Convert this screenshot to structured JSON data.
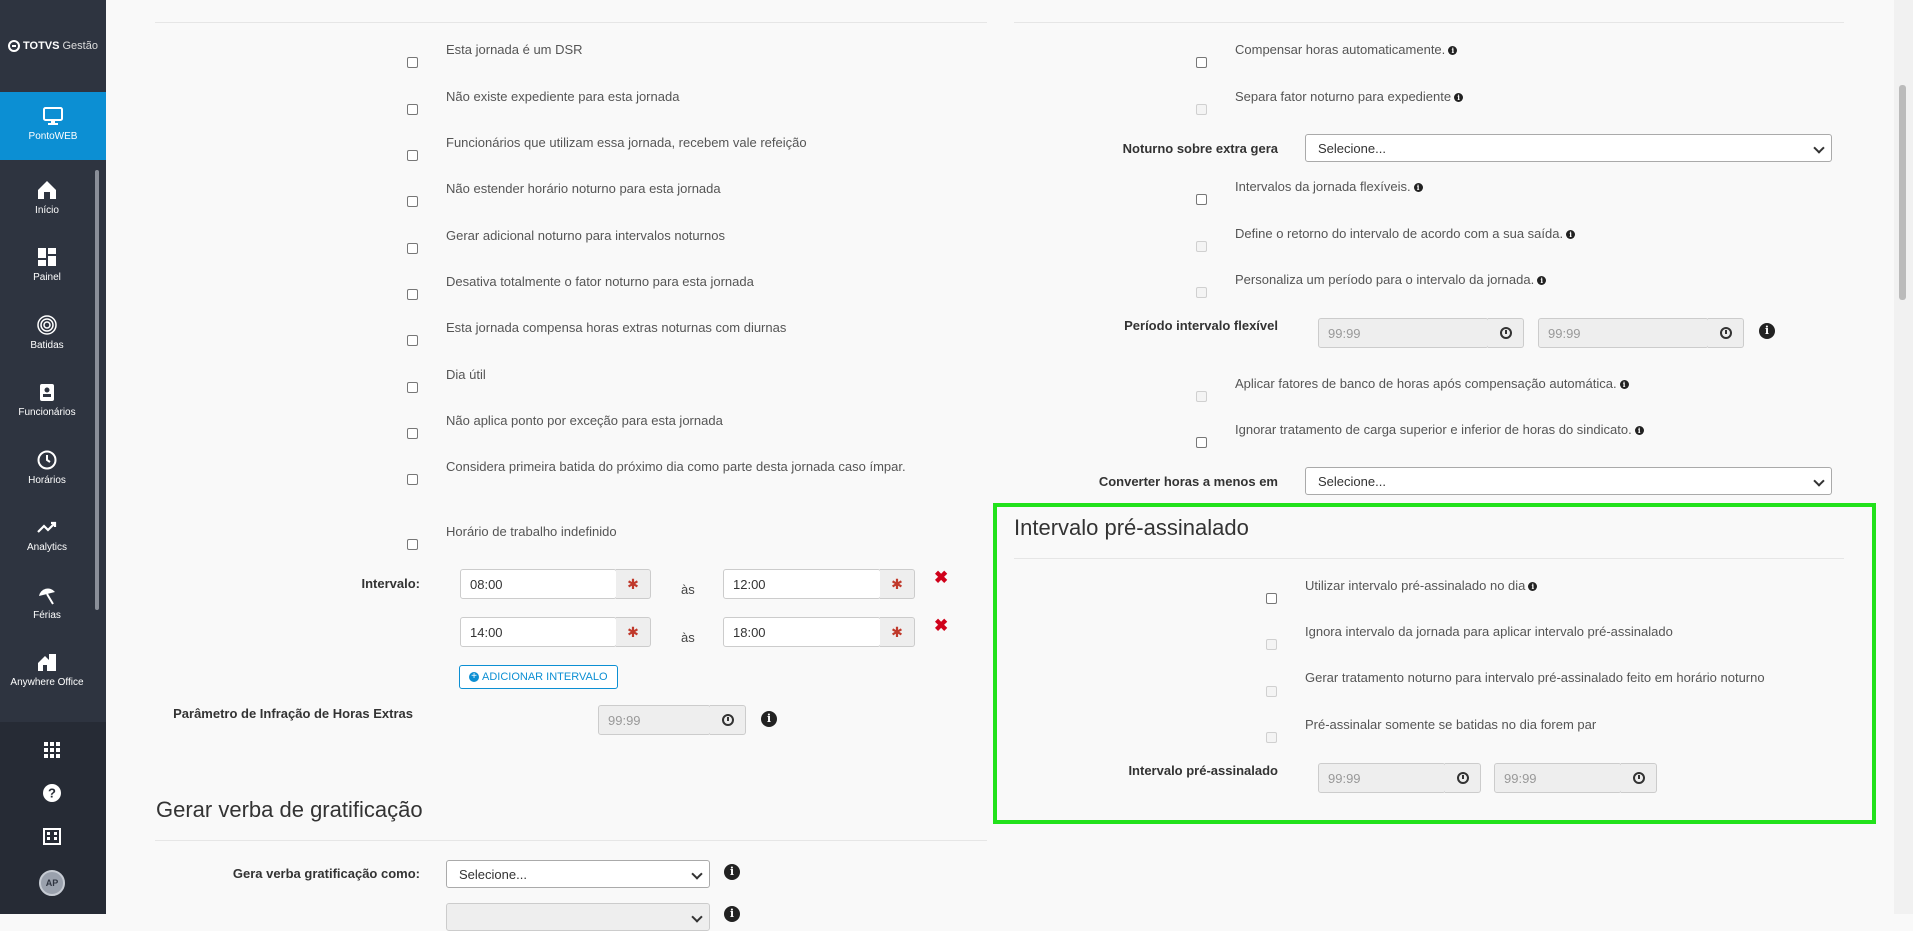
{
  "sidebar": {
    "logo_brand": "TOTVS",
    "logo_product": "Gestão",
    "items": [
      {
        "label": "PontoWEB",
        "icon": "monitor-icon"
      },
      {
        "label": "Início",
        "icon": "home-icon"
      },
      {
        "label": "Painel",
        "icon": "dashboard-icon"
      },
      {
        "label": "Batidas",
        "icon": "fingerprint-icon"
      },
      {
        "label": "Funcionários",
        "icon": "badge-icon"
      },
      {
        "label": "Horários",
        "icon": "clock-icon"
      },
      {
        "label": "Analytics",
        "icon": "trend-icon"
      },
      {
        "label": "Férias",
        "icon": "umbrella-icon"
      },
      {
        "label": "Anywhere Office",
        "icon": "house-building-icon"
      }
    ],
    "bottom_icons": [
      "apps-grid-icon",
      "help-icon",
      "building-icon"
    ],
    "avatar_initials": "AP",
    "colors": {
      "background": "#2e3440",
      "active": "#0c8fd3"
    }
  },
  "left_checks": [
    "Esta jornada é um DSR",
    "Não existe expediente para esta jornada",
    "Funcionários que utilizam essa jornada, recebem vale refeição",
    "Não estender horário noturno para esta jornada",
    "Gerar adicional noturno para intervalos noturnos",
    "Desativa totalmente o fator noturno para esta jornada",
    "Esta jornada compensa horas extras noturnas com diurnas",
    "Dia útil",
    "Não aplica ponto por exceção para esta jornada",
    "Considera primeira batida do próximo dia como parte desta jornada caso ímpar.",
    "Horário de trabalho indefinido"
  ],
  "intervalo": {
    "label": "Intervalo:",
    "separator": "às",
    "rows": [
      {
        "start": "08:00",
        "end": "12:00"
      },
      {
        "start": "14:00",
        "end": "18:00"
      }
    ],
    "add_button": "ADICIONAR INTERVALO"
  },
  "infracao": {
    "label": "Parâmetro de Infração de Horas Extras",
    "placeholder": "99:99"
  },
  "gratificacao": {
    "title": "Gerar verba de gratificação",
    "field_label": "Gera verba gratificação como:",
    "select_value": "Selecione..."
  },
  "right": {
    "checks_top": [
      {
        "label": "Compensar horas automaticamente.",
        "info": true,
        "disabled": false
      },
      {
        "label": "Separa fator noturno para expediente",
        "info": true,
        "disabled": true
      }
    ],
    "noturno_label": "Noturno sobre extra gera",
    "noturno_value": "Selecione...",
    "checks_mid": [
      {
        "label": "Intervalos da jornada flexíveis.",
        "info": true,
        "disabled": false
      },
      {
        "label": "Define o retorno do intervalo de acordo com a sua saída.",
        "info": true,
        "disabled": true
      },
      {
        "label": "Personaliza um período para o intervalo da jornada.",
        "info": true,
        "disabled": true
      }
    ],
    "periodo_label": "Período intervalo flexível",
    "periodo_placeholder": "99:99",
    "checks_low": [
      {
        "label": "Aplicar fatores de banco de horas após compensação automática.",
        "info": true,
        "disabled": true
      },
      {
        "label": "Ignorar tratamento de carga superior e inferior de horas do sindicato.",
        "info": true,
        "disabled": false
      }
    ],
    "converter_label": "Converter horas a menos em",
    "converter_value": "Selecione..."
  },
  "pre_assinalado": {
    "title": "Intervalo pré-assinalado",
    "checks": [
      {
        "label": "Utilizar intervalo pré-assinalado no dia",
        "info": true,
        "disabled": false
      },
      {
        "label": "Ignora intervalo da jornada para aplicar intervalo pré-assinalado",
        "info": false,
        "disabled": true
      },
      {
        "label": "Gerar tratamento noturno para intervalo pré-assinalado feito em horário noturno",
        "info": false,
        "disabled": true
      },
      {
        "label": "Pré-assinalar somente se batidas no dia forem par",
        "info": false,
        "disabled": true
      }
    ],
    "field_label": "Intervalo pré-assinalado",
    "placeholder": "99:99",
    "highlight_color": "#22e21b"
  }
}
